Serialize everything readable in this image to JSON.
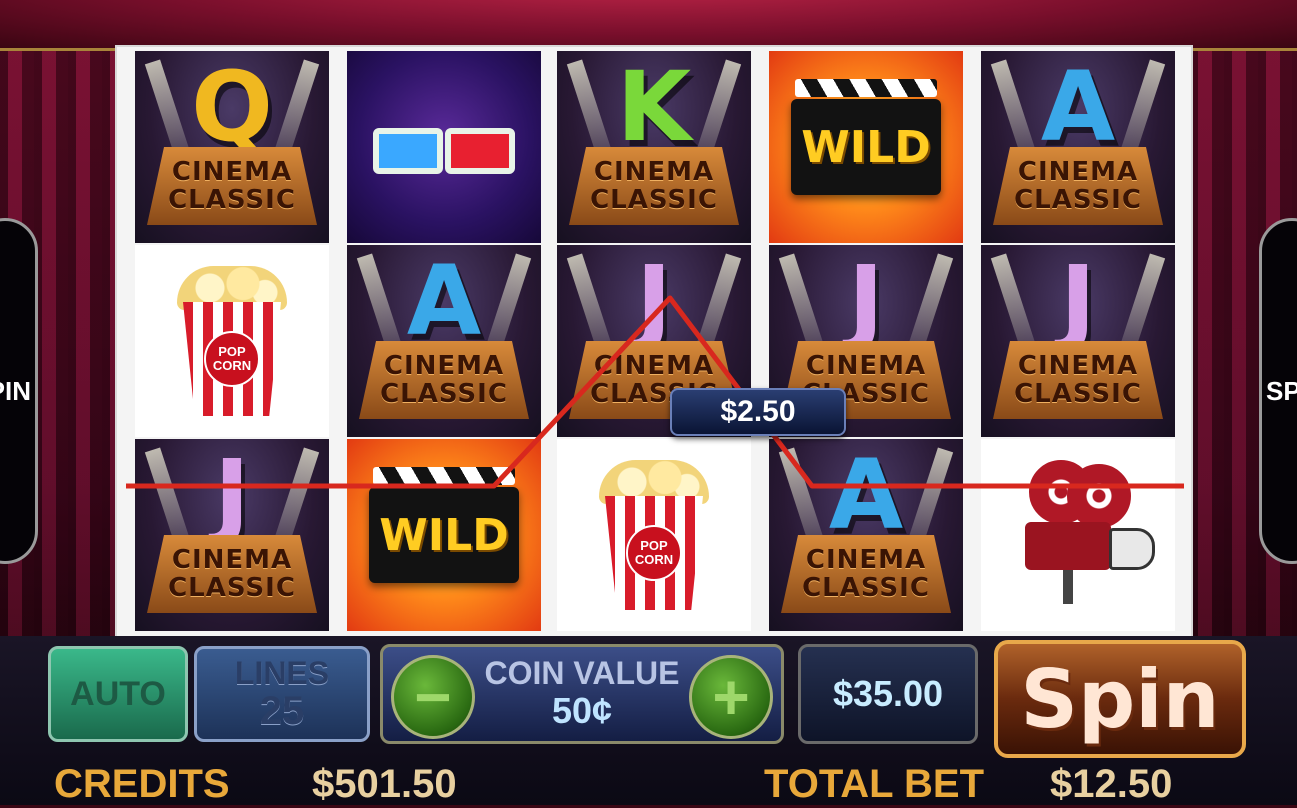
{
  "side_panels": {
    "left_text": "PIN",
    "right_text": "SP"
  },
  "reels": [
    [
      {
        "type": "cinema",
        "letter": "Q",
        "color": "#f0b820"
      },
      {
        "type": "popcorn"
      },
      {
        "type": "cinema",
        "letter": "J",
        "color": "#d8a0e8"
      }
    ],
    [
      {
        "type": "glasses"
      },
      {
        "type": "cinema",
        "letter": "A",
        "color": "#3aa8e8"
      },
      {
        "type": "wild"
      }
    ],
    [
      {
        "type": "cinema",
        "letter": "K",
        "color": "#7ad83a"
      },
      {
        "type": "cinema",
        "letter": "J",
        "color": "#d8a0e8"
      },
      {
        "type": "popcorn"
      }
    ],
    [
      {
        "type": "wild"
      },
      {
        "type": "cinema",
        "letter": "J",
        "color": "#d8a0e8"
      },
      {
        "type": "cinema",
        "letter": "A",
        "color": "#3aa8e8"
      }
    ],
    [
      {
        "type": "cinema",
        "letter": "A",
        "color": "#3aa8e8"
      },
      {
        "type": "cinema",
        "letter": "J",
        "color": "#d8a0e8"
      },
      {
        "type": "projector"
      }
    ]
  ],
  "symbol_text": {
    "plinth_line1": "CINEMA",
    "plinth_line2": "CLASSIC",
    "wild_label": "WILD",
    "popcorn_badge": "POP CORN"
  },
  "payline": {
    "color": "#d8281e",
    "win_amount": "$2.50"
  },
  "controls": {
    "auto_label": "AUTO",
    "lines_label": "LINES",
    "lines_value": "25",
    "coin_label": "COIN VALUE",
    "coin_value": "50¢",
    "minus_symbol": "−",
    "plus_symbol": "+",
    "bet_value": "$35.00",
    "spin_label": "Spin"
  },
  "status": {
    "credits_label": "CREDITS",
    "credits_value": "$501.50",
    "total_bet_label": "TOTAL BET",
    "total_bet_value": "$12.50"
  }
}
